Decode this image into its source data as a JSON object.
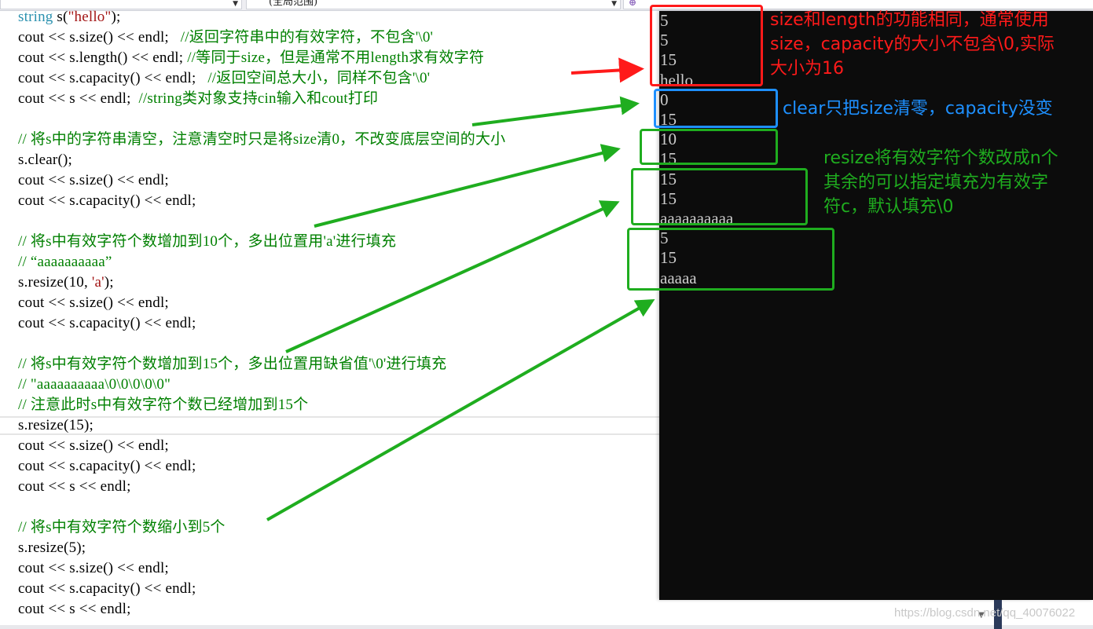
{
  "toolbar": {
    "dropdown_left": "",
    "dropdown_scope": "(全局范围)",
    "dropdown_member": "",
    "project_icon": "class-icon"
  },
  "code": {
    "lines": [
      {
        "segments": [
          {
            "t": "string",
            "c": "kw-type"
          },
          {
            "t": " s(",
            "c": ""
          },
          {
            "t": "\"hello\"",
            "c": "str"
          },
          {
            "t": ");",
            "c": ""
          }
        ]
      },
      {
        "segments": [
          {
            "t": "cout << s.size() << endl;   ",
            "c": ""
          },
          {
            "t": "//返回字符串中的有效字符，不包含'\\0'",
            "c": "cmt"
          }
        ]
      },
      {
        "segments": [
          {
            "t": "cout << s.length() << endl; ",
            "c": ""
          },
          {
            "t": "//等同于size，但是通常不用length求有效字符",
            "c": "cmt"
          }
        ]
      },
      {
        "segments": [
          {
            "t": "cout << s.capacity() << endl;   ",
            "c": ""
          },
          {
            "t": "//返回空间总大小，同样不包含'\\0'",
            "c": "cmt"
          }
        ]
      },
      {
        "segments": [
          {
            "t": "cout << s << endl;  ",
            "c": ""
          },
          {
            "t": "//string类对象支持cin输入和cout打印",
            "c": "cmt"
          }
        ]
      },
      {
        "segments": []
      },
      {
        "segments": [
          {
            "t": "// 将s中的字符串清空，注意清空时只是将size清0，不改变底层空间的大小",
            "c": "cmt"
          }
        ]
      },
      {
        "segments": [
          {
            "t": "s.clear();",
            "c": ""
          }
        ]
      },
      {
        "segments": [
          {
            "t": "cout << s.size() << endl;",
            "c": ""
          }
        ]
      },
      {
        "segments": [
          {
            "t": "cout << s.capacity() << endl;",
            "c": ""
          }
        ]
      },
      {
        "segments": []
      },
      {
        "segments": [
          {
            "t": "// 将s中有效字符个数增加到10个，多出位置用'a'进行填充",
            "c": "cmt"
          }
        ]
      },
      {
        "segments": [
          {
            "t": "// “aaaaaaaaaa”",
            "c": "cmt"
          }
        ]
      },
      {
        "segments": [
          {
            "t": "s.resize(10, ",
            "c": ""
          },
          {
            "t": "'a'",
            "c": "str"
          },
          {
            "t": ");",
            "c": ""
          }
        ]
      },
      {
        "segments": [
          {
            "t": "cout << s.size() << endl;",
            "c": ""
          }
        ]
      },
      {
        "segments": [
          {
            "t": "cout << s.capacity() << endl;",
            "c": ""
          }
        ]
      },
      {
        "segments": []
      },
      {
        "segments": [
          {
            "t": "// 将s中有效字符个数增加到15个，多出位置用缺省值'\\0'进行填充",
            "c": "cmt"
          }
        ]
      },
      {
        "segments": [
          {
            "t": "// \"aaaaaaaaaa\\0\\0\\0\\0\\0\"",
            "c": "cmt"
          }
        ]
      },
      {
        "segments": [
          {
            "t": "// 注意此时s中有效字符个数已经增加到15个",
            "c": "cmt"
          }
        ]
      },
      {
        "segments": [
          {
            "t": "s.resize(15);",
            "c": ""
          }
        ]
      },
      {
        "segments": [
          {
            "t": "cout << s.size() << endl;",
            "c": ""
          }
        ]
      },
      {
        "segments": [
          {
            "t": "cout << s.capacity() << endl;",
            "c": ""
          }
        ]
      },
      {
        "segments": [
          {
            "t": "cout << s << endl;",
            "c": ""
          }
        ]
      },
      {
        "segments": []
      },
      {
        "segments": [
          {
            "t": "// 将s中有效字符个数缩小到5个",
            "c": "cmt"
          }
        ]
      },
      {
        "segments": [
          {
            "t": "s.resize(5);",
            "c": ""
          }
        ]
      },
      {
        "segments": [
          {
            "t": "cout << s.size() << endl;",
            "c": ""
          }
        ]
      },
      {
        "segments": [
          {
            "t": "cout << s.capacity() << endl;",
            "c": ""
          }
        ]
      },
      {
        "segments": [
          {
            "t": "cout << s << endl;",
            "c": ""
          }
        ]
      }
    ],
    "current_line_index": 20
  },
  "console": {
    "output": [
      "5",
      "5",
      "15",
      "hello",
      "0",
      "15",
      "10",
      "15",
      "15",
      "15",
      "aaaaaaaaaa",
      "5",
      "15",
      "aaaaa"
    ]
  },
  "annotations": {
    "red_note": "size和length的功能相同，通常使用\nsize，capacity的大小不包含\\0,实际\n大小为16",
    "blue_note": "clear只把size清零，capacity没变",
    "green_note": "resize将有效字符个数改成n个\n其余的可以指定填充为有效字\n符c，默认填充\\0",
    "colors": {
      "red": "#ff1a1a",
      "blue": "#1e90ff",
      "green": "#1fad1f"
    }
  },
  "watermark": "https://blog.csdn.net/qq_40076022"
}
